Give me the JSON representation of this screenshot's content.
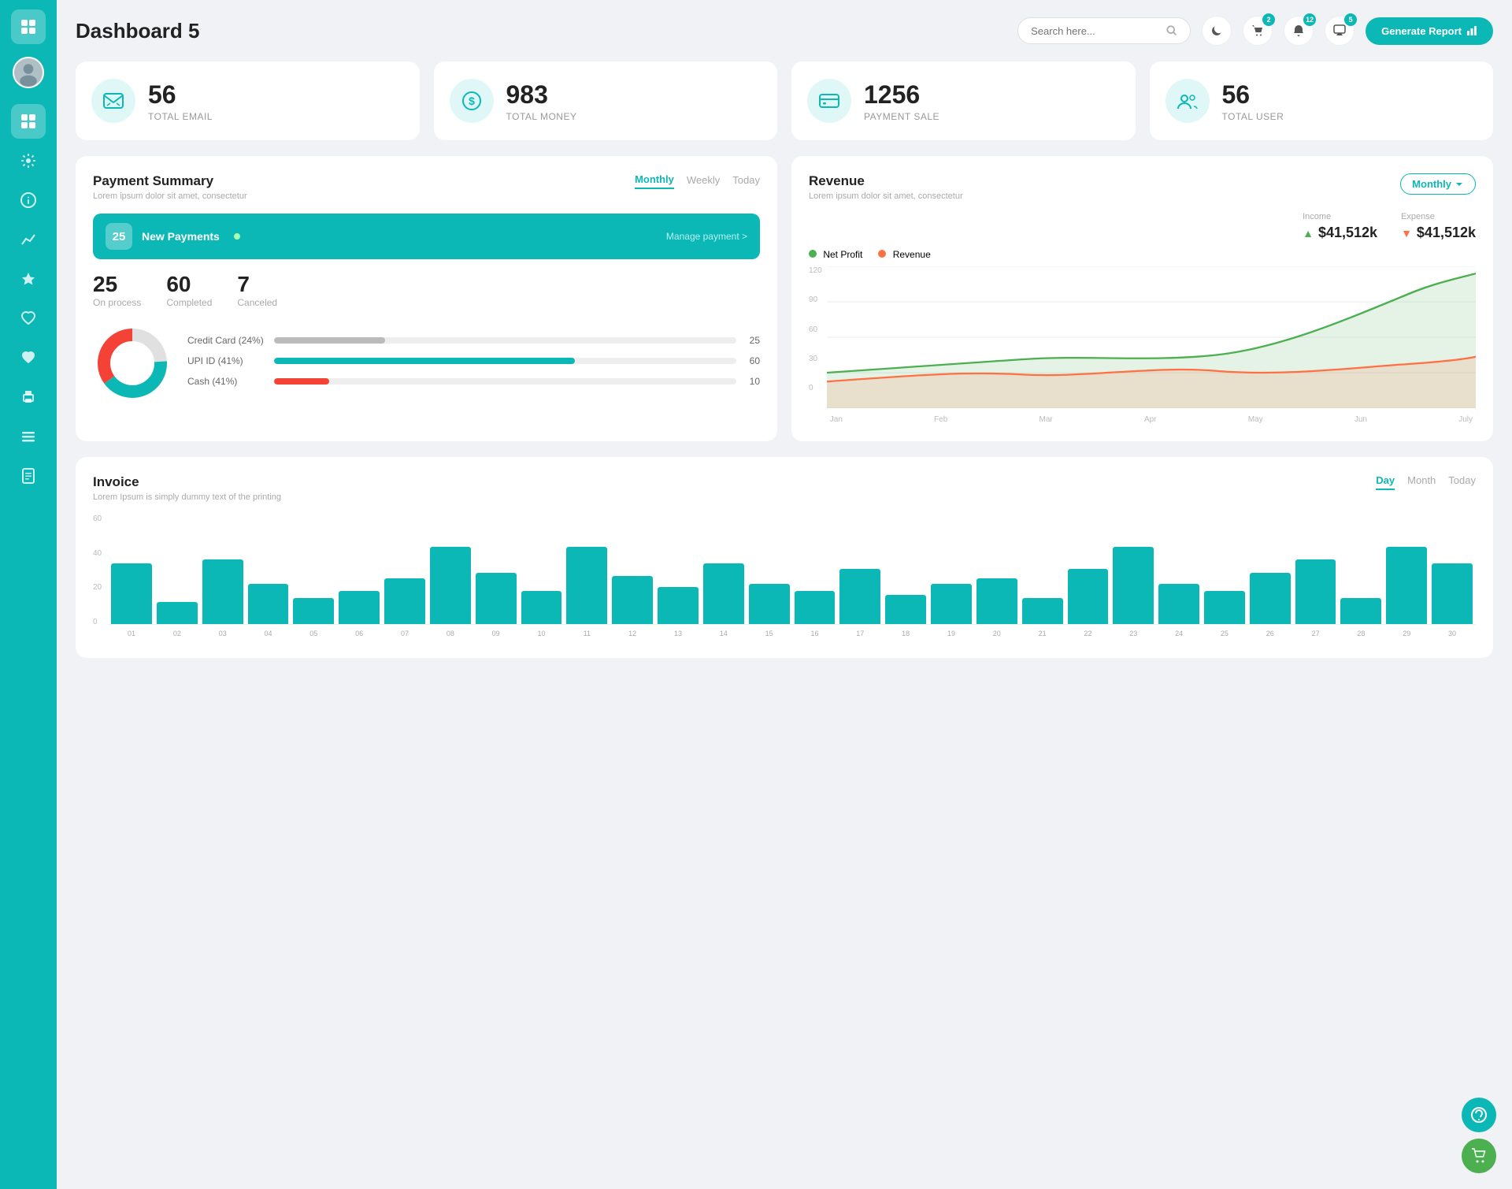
{
  "sidebar": {
    "logo": "💼",
    "items": [
      {
        "id": "dashboard",
        "icon": "⊞",
        "active": true
      },
      {
        "id": "settings",
        "icon": "⚙"
      },
      {
        "id": "info",
        "icon": "ℹ"
      },
      {
        "id": "chart",
        "icon": "📊"
      },
      {
        "id": "star",
        "icon": "★"
      },
      {
        "id": "heart-outline",
        "icon": "♡"
      },
      {
        "id": "heart-solid",
        "icon": "♥"
      },
      {
        "id": "print",
        "icon": "🖨"
      },
      {
        "id": "list",
        "icon": "≡"
      },
      {
        "id": "document",
        "icon": "📋"
      }
    ]
  },
  "header": {
    "title": "Dashboard 5",
    "search_placeholder": "Search here...",
    "badge_cart": "2",
    "badge_bell": "12",
    "badge_chat": "5",
    "generate_btn": "Generate Report"
  },
  "stats": [
    {
      "id": "email",
      "number": "56",
      "label": "TOTAL EMAIL",
      "icon": "📧"
    },
    {
      "id": "money",
      "number": "983",
      "label": "TOTAL MONEY",
      "icon": "💲"
    },
    {
      "id": "payment",
      "number": "1256",
      "label": "PAYMENT SALE",
      "icon": "💳"
    },
    {
      "id": "user",
      "number": "56",
      "label": "TOTAL USER",
      "icon": "👥"
    }
  ],
  "payment_summary": {
    "title": "Payment Summary",
    "subtitle": "Lorem ipsum dolor sit amet, consectetur",
    "tabs": [
      "Monthly",
      "Weekly",
      "Today"
    ],
    "active_tab": "Monthly",
    "new_payments_count": "25",
    "new_payments_label": "New Payments",
    "manage_link": "Manage payment >",
    "on_process": "25",
    "on_process_label": "On process",
    "completed": "60",
    "completed_label": "Completed",
    "canceled": "7",
    "canceled_label": "Canceled",
    "payment_methods": [
      {
        "label": "Credit Card (24%)",
        "value": 24,
        "color": "#bbb",
        "count": "25"
      },
      {
        "label": "UPI ID (41%)",
        "value": 65,
        "color": "#0cb8b6",
        "count": "60"
      },
      {
        "label": "Cash (41%)",
        "value": 10,
        "color": "#f44336",
        "count": "10"
      }
    ]
  },
  "revenue": {
    "title": "Revenue",
    "subtitle": "Lorem ipsum dolor sit amet, consectetur",
    "dropdown_label": "Monthly",
    "income_label": "Income",
    "income_value": "$41,512k",
    "expense_label": "Expense",
    "expense_value": "$41,512k",
    "legend": [
      {
        "label": "Net Profit",
        "color": "#4caf50"
      },
      {
        "label": "Revenue",
        "color": "#ff7043"
      }
    ],
    "months": [
      "Jan",
      "Feb",
      "Mar",
      "Apr",
      "May",
      "Jun",
      "July"
    ],
    "y_labels": [
      "120",
      "90",
      "60",
      "30",
      "0"
    ]
  },
  "invoice": {
    "title": "Invoice",
    "subtitle": "Lorem Ipsum is simply dummy text of the printing",
    "tabs": [
      "Day",
      "Month",
      "Today"
    ],
    "active_tab": "Day",
    "y_labels": [
      "60",
      "40",
      "20",
      "0"
    ],
    "x_labels": [
      "01",
      "02",
      "03",
      "04",
      "05",
      "06",
      "07",
      "08",
      "09",
      "10",
      "11",
      "12",
      "13",
      "14",
      "15",
      "16",
      "17",
      "18",
      "19",
      "20",
      "21",
      "22",
      "23",
      "24",
      "25",
      "26",
      "27",
      "28",
      "29",
      "30"
    ],
    "bars": [
      33,
      12,
      35,
      22,
      14,
      18,
      25,
      42,
      28,
      18,
      42,
      26,
      20,
      33,
      22,
      18,
      30,
      16,
      22,
      25,
      14,
      30,
      42,
      22,
      18,
      28,
      35,
      14,
      42,
      33
    ]
  },
  "fab": {
    "support_icon": "💬",
    "cart_icon": "🛒"
  }
}
